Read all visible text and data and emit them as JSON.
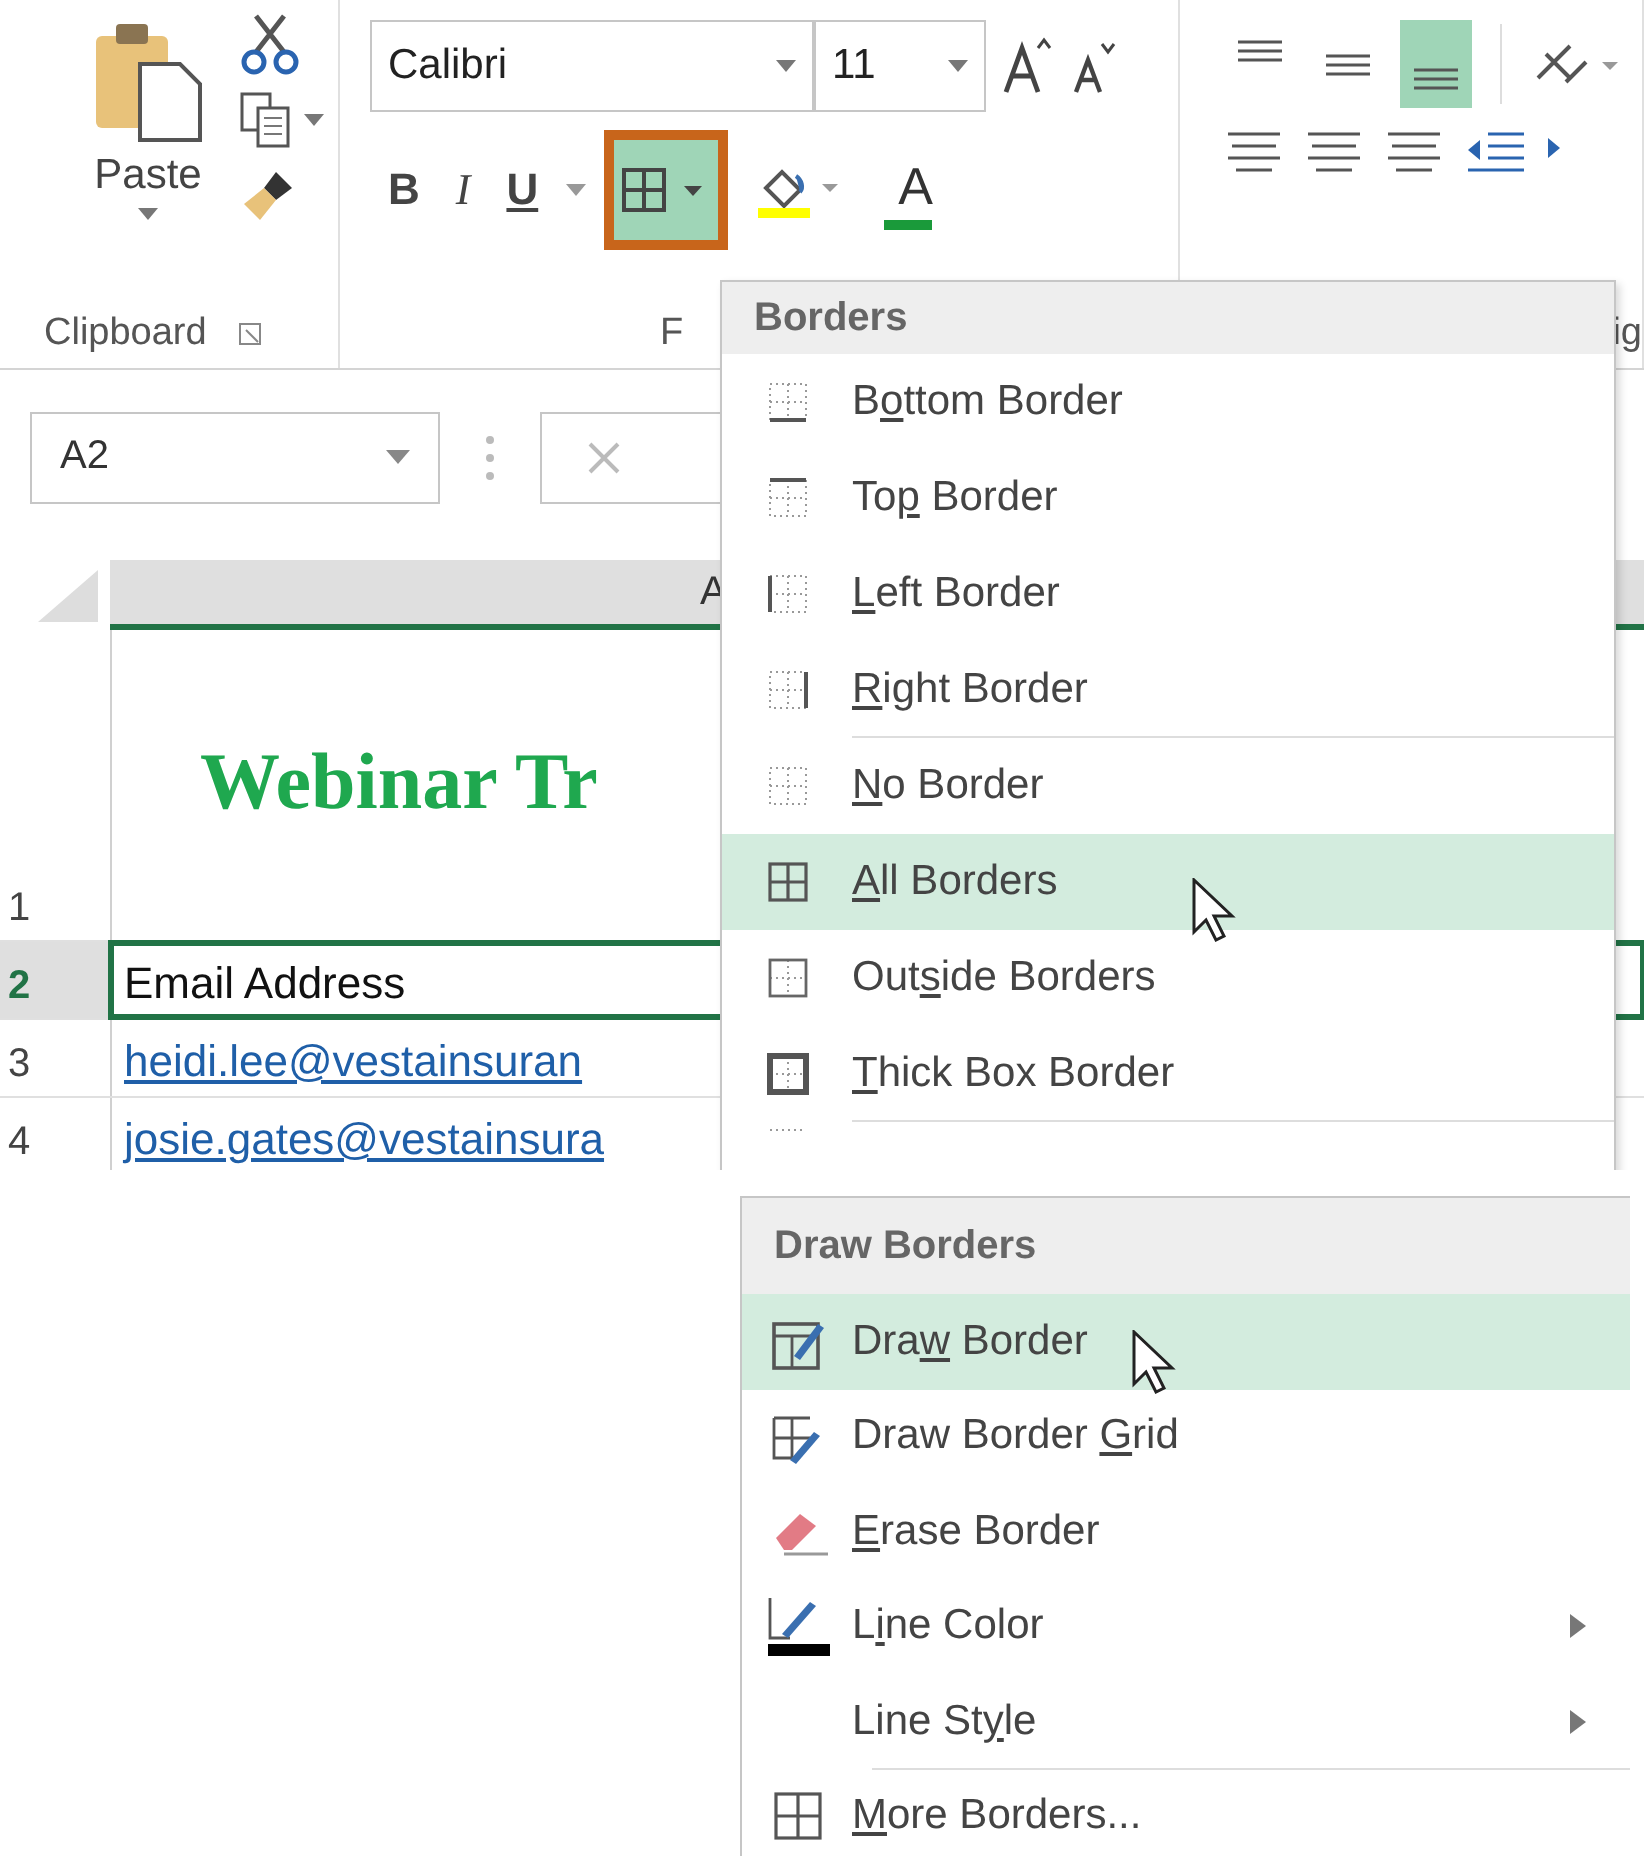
{
  "ribbon": {
    "clipboard": {
      "paste_label": "Paste",
      "group_label": "Clipboard"
    },
    "font": {
      "font_name": "Calibri",
      "font_size": "11",
      "group_label": "F",
      "buttons": [
        {
          "kind": "bold",
          "label": "B",
          "selected": false
        },
        {
          "kind": "italic",
          "label": "I",
          "selected": false
        },
        {
          "kind": "underline",
          "label": "U",
          "selected": false
        },
        {
          "kind": "borders",
          "selected": true
        },
        {
          "kind": "fill",
          "selected": false
        },
        {
          "kind": "fontcolor",
          "label": "A",
          "selected": false
        }
      ]
    },
    "alignment": {
      "group_label": "ig",
      "vertical": [
        {
          "selected": false
        },
        {
          "selected": false
        },
        {
          "selected": true
        }
      ]
    }
  },
  "formula_bar": {
    "name_box": "A2"
  },
  "sheet": {
    "column_header": "A",
    "rows": [
      {
        "number": "1",
        "kind": "title",
        "value": "Webinar Tr",
        "selected": false
      },
      {
        "number": "2",
        "kind": "header",
        "value": "Email Address",
        "selected": true
      },
      {
        "number": "3",
        "kind": "link",
        "value": "heidi.lee@vestainsuran",
        "selected": false
      },
      {
        "number": "4",
        "kind": "link",
        "value": "josie.gates@vestainsura",
        "selected": false
      }
    ]
  },
  "borders_menu": {
    "title": "Borders",
    "items": [
      {
        "before": "B",
        "key": "o",
        "after": "ttom Border",
        "selected": false,
        "separator_after": false
      },
      {
        "before": "To",
        "key": "p",
        "after": " Border",
        "selected": false,
        "separator_after": false
      },
      {
        "key": "L",
        "after": "eft Border",
        "selected": false,
        "separator_after": false
      },
      {
        "key": "R",
        "after": "ight Border",
        "selected": false,
        "separator_after": true
      },
      {
        "key": "N",
        "after": "o Border",
        "selected": false,
        "separator_after": false
      },
      {
        "key": "A",
        "after": "ll Borders",
        "selected": true,
        "separator_after": false
      },
      {
        "before": "Out",
        "key": "s",
        "after": "ide Borders",
        "selected": false,
        "separator_after": false
      },
      {
        "key": "T",
        "after": "hick Box Border",
        "selected": false,
        "separator_after": true
      }
    ]
  },
  "draw_borders_menu": {
    "title": "Draw Borders",
    "items": [
      {
        "before": "Dra",
        "key": "w",
        "after": " Border",
        "selected": true,
        "submenu": false,
        "separator_after": false
      },
      {
        "before": "Draw Border ",
        "key": "G",
        "after": "rid",
        "selected": false,
        "submenu": false,
        "separator_after": false
      },
      {
        "key": "E",
        "after": "rase Border",
        "selected": false,
        "submenu": false,
        "separator_after": false
      },
      {
        "before": "L",
        "key": "i",
        "after": "ne Color",
        "selected": false,
        "submenu": true,
        "separator_after": false
      },
      {
        "before": "Line St",
        "key": "y",
        "after": "le",
        "selected": false,
        "submenu": true,
        "separator_after": true
      },
      {
        "key": "M",
        "after": "ore Borders...",
        "selected": false,
        "submenu": false,
        "separator_after": false
      }
    ]
  }
}
